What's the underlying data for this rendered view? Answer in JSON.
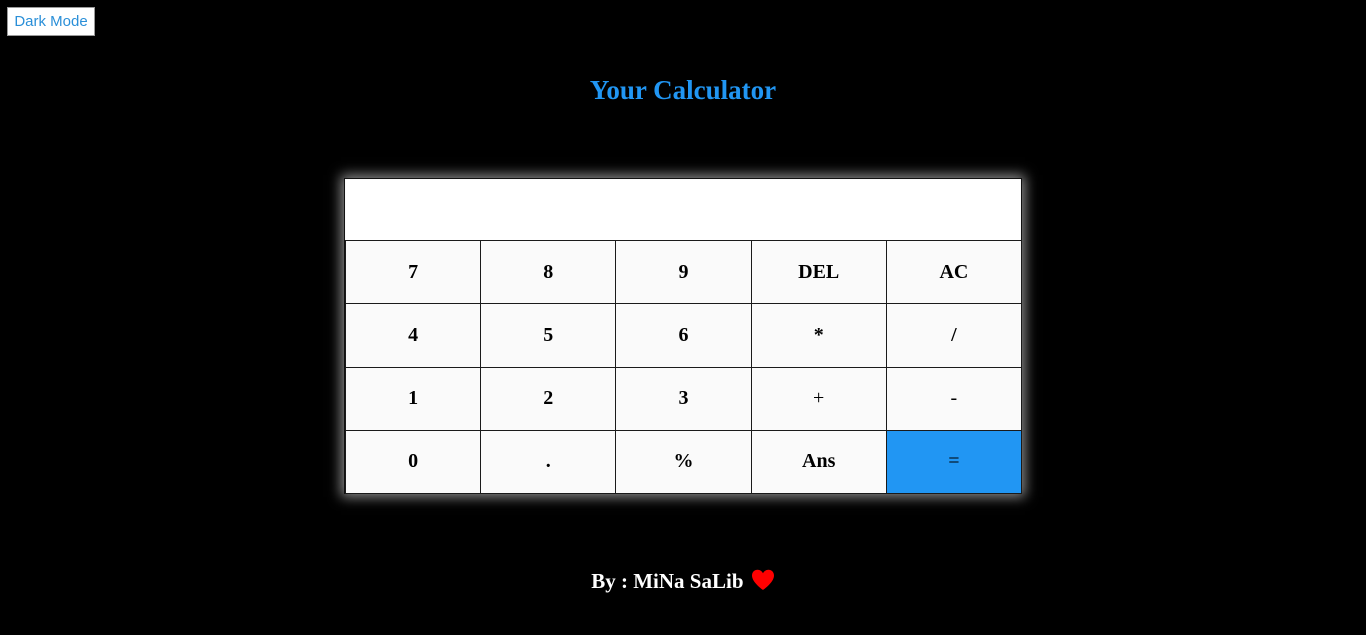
{
  "toolbar": {
    "mode_toggle_label": "Dark Mode"
  },
  "header": {
    "title": "Your Calculator"
  },
  "calculator": {
    "display_value": "",
    "keys": [
      {
        "label": "7"
      },
      {
        "label": "8"
      },
      {
        "label": "9"
      },
      {
        "label": "DEL"
      },
      {
        "label": "AC"
      },
      {
        "label": "4"
      },
      {
        "label": "5"
      },
      {
        "label": "6"
      },
      {
        "label": "*"
      },
      {
        "label": "/"
      },
      {
        "label": "1"
      },
      {
        "label": "2"
      },
      {
        "label": "3"
      },
      {
        "label": "+"
      },
      {
        "label": "-"
      },
      {
        "label": "0"
      },
      {
        "label": "."
      },
      {
        "label": "%"
      },
      {
        "label": "Ans"
      },
      {
        "label": "="
      }
    ],
    "equals_color": "#2196f3"
  },
  "footer": {
    "credit": "By : MiNa SaLib",
    "icon": "heart-icon",
    "icon_color": "#ff0000"
  },
  "colors": {
    "background": "#000000",
    "accent": "#2196f3",
    "key_background": "#fafafa"
  }
}
